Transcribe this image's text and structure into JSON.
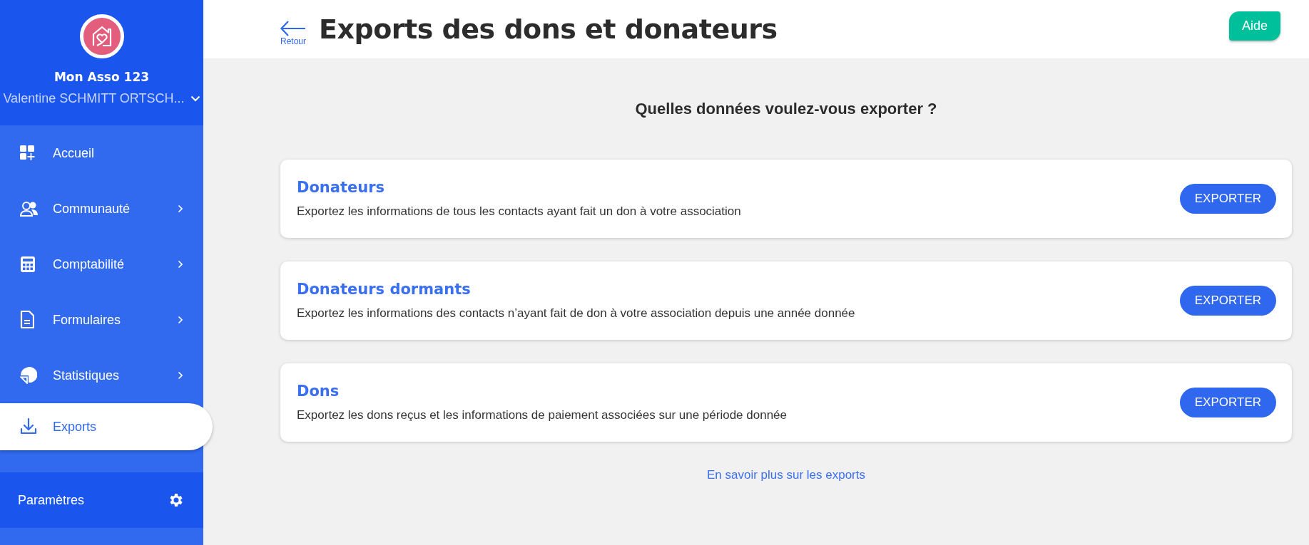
{
  "sidebar": {
    "org_name": "Mon Asso 123",
    "user_name": "Valentine SCHMITT ORTSCH...",
    "items": [
      {
        "label": "Accueil",
        "has_submenu": false,
        "selected": false
      },
      {
        "label": "Communauté",
        "has_submenu": true,
        "selected": false
      },
      {
        "label": "Comptabilité",
        "has_submenu": true,
        "selected": false
      },
      {
        "label": "Formulaires",
        "has_submenu": true,
        "selected": false
      },
      {
        "label": "Statistiques",
        "has_submenu": true,
        "selected": false
      },
      {
        "label": "Exports",
        "has_submenu": false,
        "selected": true
      }
    ],
    "settings_label": "Paramètres"
  },
  "header": {
    "back_label": "Retour",
    "title": "Exports des dons et donateurs",
    "help_button": "Aide"
  },
  "question": "Quelles données voulez-vous exporter ?",
  "export_cards": [
    {
      "title": "Donateurs",
      "description": "Exportez les informations de tous les contacts ayant fait un don à votre association",
      "button": "EXPORTER"
    },
    {
      "title": "Donateurs dormants",
      "description": "Exportez les informations des contacts n’ayant fait de don à votre association depuis une année donnée",
      "button": "EXPORTER"
    },
    {
      "title": "Dons",
      "description": "Exportez les dons reçus et les informations de paiement associées sur une période donnée",
      "button": "EXPORTER"
    }
  ],
  "more_link": "En savoir plus sur les exports"
}
